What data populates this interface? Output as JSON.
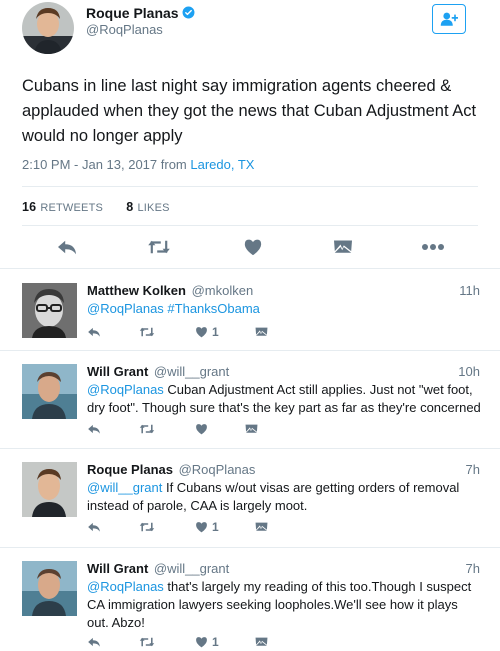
{
  "main_tweet": {
    "author_name": "Roque Planas",
    "author_handle": "@RoqPlanas",
    "verified": true,
    "text": "Cubans in line last night say immigration agents cheered & applauded when they got the news that Cuban Adjustment Act would no longer apply",
    "timestamp": "2:10 PM - Jan 13, 2017 from",
    "location": "Laredo, TX",
    "retweets_count": "16",
    "retweets_label": "RETWEETS",
    "likes_count": "8",
    "likes_label": "LIKES",
    "icons": [
      "reply-icon",
      "retweet-icon",
      "heart-icon",
      "direct-message-icon",
      "more-icon"
    ]
  },
  "replies": [
    {
      "name": "Matthew Kolken",
      "handle": "@mkolken",
      "time": "11h",
      "mention": "@RoqPlanas",
      "text": "",
      "hashtag": "#ThanksObama",
      "like_count": "1"
    },
    {
      "name": "Will Grant",
      "handle": "@will__grant",
      "time": "10h",
      "mention": "@RoqPlanas",
      "text": " Cuban Adjustment Act still applies. Just not \"wet foot, dry foot\". Though sure that's the key part as far as they're concerned",
      "like_count": ""
    },
    {
      "name": "Roque Planas",
      "handle": "@RoqPlanas",
      "time": "7h",
      "mention": "@will__grant",
      "text": " If Cubans w/out visas are getting orders of removal instead of parole, CAA is largely moot.",
      "like_count": "1"
    },
    {
      "name": "Will Grant",
      "handle": "@will__grant",
      "time": "7h",
      "mention": "@RoqPlanas",
      "text": " that's largely my reading of this too.Though I suspect CA immigration lawyers seeking loopholes.We'll see how it plays out. Abzo!",
      "like_count": "1"
    }
  ],
  "colors": {
    "accent": "#1da1f2",
    "link": "#1b95e0",
    "icon_gray": "#657786",
    "divider": "#e6ecf0"
  }
}
